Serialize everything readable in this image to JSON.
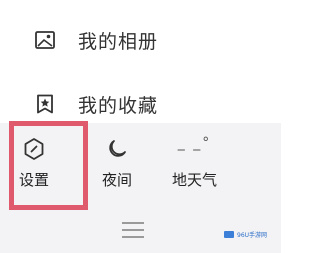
{
  "menu": {
    "items": [
      {
        "label": "我的相册",
        "icon": "photo-album-icon"
      },
      {
        "label": "我的收藏",
        "icon": "favorites-icon"
      }
    ]
  },
  "bottom_bar": {
    "settings_label": "设置",
    "night_label": "夜间",
    "weather_label": "地天气",
    "weather_value": "_ _°"
  },
  "watermark": {
    "text": "96U手游网"
  },
  "colors": {
    "highlight": "#e05a6e",
    "panel_background": "#f3f3f5"
  }
}
